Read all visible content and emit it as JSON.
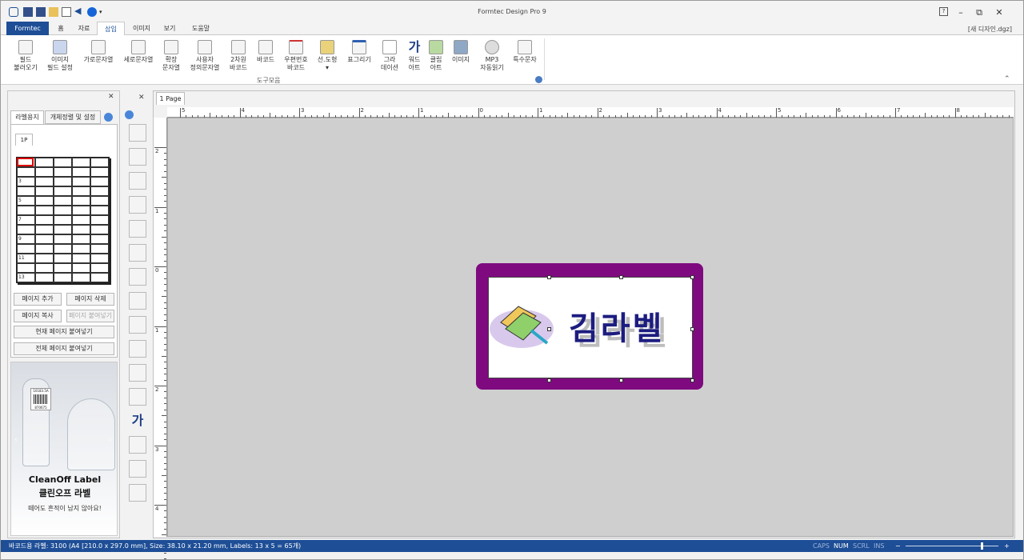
{
  "window": {
    "title": "Formtec Design Pro 9",
    "doc_name": "[새 디자인.dgz]"
  },
  "tabs": [
    "Formtec",
    "홈",
    "자료",
    "삽입",
    "이미지",
    "보기",
    "도움말"
  ],
  "ribbon": {
    "buttons": [
      {
        "l1": "필드",
        "l2": "불러오기"
      },
      {
        "l1": "이미지",
        "l2": "필드 설정"
      },
      {
        "l1": "가로문자열",
        "l2": ""
      },
      {
        "l1": "세로문자열",
        "l2": ""
      },
      {
        "l1": "확장",
        "l2": "문자열"
      },
      {
        "l1": "사용자",
        "l2": "정의문자열"
      },
      {
        "l1": "2차원",
        "l2": "바코드"
      },
      {
        "l1": "바코드",
        "l2": ""
      },
      {
        "l1": "우편번호",
        "l2": "바코드"
      },
      {
        "l1": "선.도형",
        "l2": "▾"
      },
      {
        "l1": "표그리기",
        "l2": ""
      },
      {
        "l1": "그라",
        "l2": "데이션"
      },
      {
        "l1": "워드",
        "l2": "아트"
      },
      {
        "l1": "클립",
        "l2": "아트"
      },
      {
        "l1": "이미지",
        "l2": ""
      },
      {
        "l1": "MP3",
        "l2": "자동읽기"
      },
      {
        "l1": "특수문자",
        "l2": ""
      }
    ],
    "group_label": "도구모음"
  },
  "left_panel": {
    "tabs": [
      "라벨용지",
      "개체정렬 및 설정"
    ],
    "page_tab": "1P",
    "row_numbers": [
      "3",
      "5",
      "7",
      "9",
      "11",
      "13"
    ],
    "buttons": [
      "페이지 추가",
      "페이지 삭제",
      "페이지 복사",
      "페이지 붙여넣기",
      "현재 페이지 붙여넣기",
      "전체 페이지 붙여넣기"
    ],
    "ad": {
      "brand_line1": "CleanOff Label",
      "brand_line2": "클린오프 라벨",
      "tagline": "떼어도 흔적이 남지 않아요!",
      "bottle_label": "10183.5A",
      "barcode_num": "870675"
    }
  },
  "canvas": {
    "page_tab": "1 Page",
    "hruler_labels": [
      "5",
      "4",
      "3",
      "2",
      "1",
      "0",
      "1",
      "2",
      "3",
      "4",
      "5",
      "6",
      "7",
      "8"
    ],
    "vruler_labels": [
      "2",
      "1",
      "0",
      "1",
      "2",
      "3",
      "4"
    ],
    "label_text": "김라벨"
  },
  "status": {
    "info": "바코드용 라벨: 3100 (A4 [210.0 x 297.0 mm], Size: 38.10 x 21.20 mm,  Labels: 13 x 5 = 65개)",
    "caps": "CAPS",
    "num": "NUM",
    "scrl": "SCRL",
    "ins": "INS",
    "minus": "−",
    "plus": "+"
  },
  "colors": {
    "accent": "#1e4e96",
    "label_border": "#7f0a7f"
  }
}
